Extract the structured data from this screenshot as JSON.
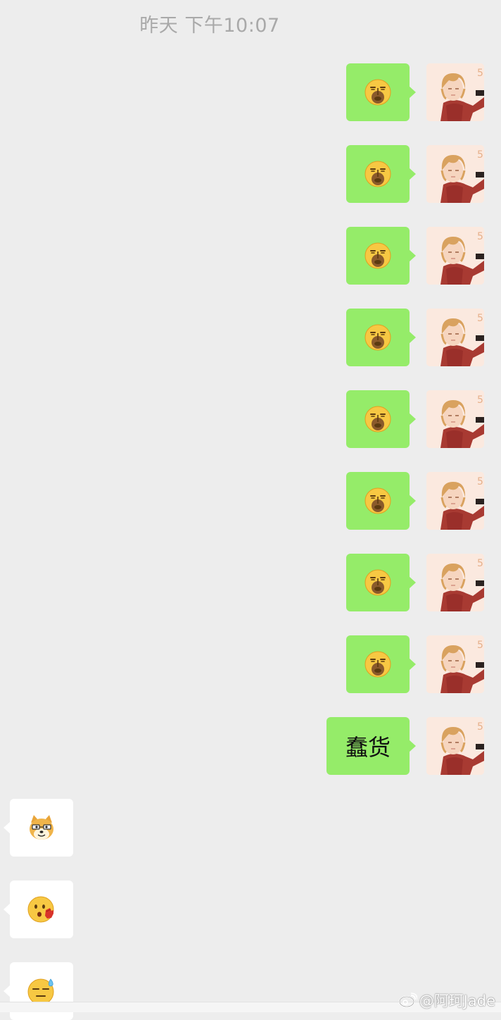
{
  "chat": {
    "timestamp": "昨天 下午10:07",
    "messages": [
      {
        "direction": "outgoing",
        "type": "emoji",
        "emoji": "yawn-face-emoji"
      },
      {
        "direction": "outgoing",
        "type": "emoji",
        "emoji": "yawn-face-emoji"
      },
      {
        "direction": "outgoing",
        "type": "emoji",
        "emoji": "yawn-face-emoji"
      },
      {
        "direction": "outgoing",
        "type": "emoji",
        "emoji": "yawn-face-emoji"
      },
      {
        "direction": "outgoing",
        "type": "emoji",
        "emoji": "yawn-face-emoji"
      },
      {
        "direction": "outgoing",
        "type": "emoji",
        "emoji": "yawn-face-emoji"
      },
      {
        "direction": "outgoing",
        "type": "emoji",
        "emoji": "yawn-face-emoji"
      },
      {
        "direction": "outgoing",
        "type": "emoji",
        "emoji": "yawn-face-emoji"
      },
      {
        "direction": "outgoing",
        "type": "text",
        "text": "蠢货"
      },
      {
        "direction": "incoming",
        "type": "emoji",
        "emoji": "doge-emoji"
      },
      {
        "direction": "incoming",
        "type": "emoji",
        "emoji": "slap-face-emoji"
      },
      {
        "direction": "incoming",
        "type": "emoji",
        "emoji": "sweat-face-emoji"
      }
    ]
  },
  "watermark": {
    "text": "@阿珂Jade"
  },
  "colors": {
    "background": "#ededed",
    "outgoing_bubble": "#95ec69",
    "incoming_bubble": "#ffffff"
  }
}
